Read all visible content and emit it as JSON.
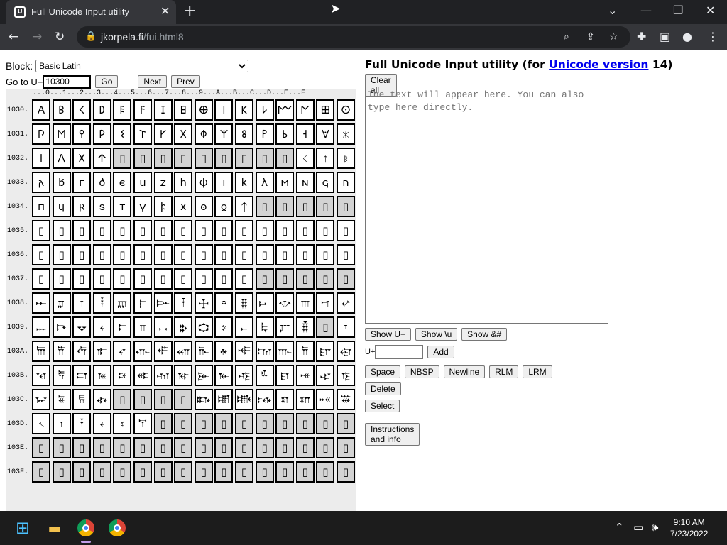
{
  "tab": {
    "title": "Full Unicode Input utility",
    "close": "✕",
    "new_tab": "+"
  },
  "window_controls": {
    "minimize": "—",
    "restore": "❐",
    "close": "✕",
    "tabs_menu": "⌄"
  },
  "toolbar": {
    "back": "←",
    "forward": "→",
    "reload": "↻",
    "url_host": "jkorpela.fi",
    "url_path": "/fui.html8"
  },
  "left": {
    "block_label": "Block:",
    "block_selected": "Basic Latin",
    "goto_label": "Go to U+",
    "goto_value": "10300",
    "go_button": "Go",
    "next_button": "Next",
    "prev_button": "Prev",
    "column_header": "...0...1...2...3...4...5...6...7...8...9...A...B...C...D...E...F"
  },
  "grid_rows": [
    {
      "label": "1030.",
      "cells": [
        "𐌀",
        "𐌁",
        "𐌂",
        "𐌃",
        "𐌄",
        "𐌅",
        "𐌆",
        "𐌇",
        "𐌈",
        "𐌉",
        "𐌊",
        "𐌋",
        "𐌌",
        "𐌍",
        "𐌎",
        "𐌏"
      ],
      "na": []
    },
    {
      "label": "1031.",
      "cells": [
        "𐌐",
        "𐌑",
        "𐌒",
        "𐌓",
        "𐌔",
        "𐌕",
        "𐌖",
        "𐌗",
        "𐌘",
        "𐌙",
        "𐌚",
        "𐌛",
        "𐌜",
        "𐌝",
        "𐌞",
        "𐌟"
      ],
      "na": []
    },
    {
      "label": "1032.",
      "cells": [
        "𐌠",
        "𐌡",
        "𐌢",
        "𐌣",
        "▯",
        "▯",
        "▯",
        "▯",
        "▯",
        "▯",
        "▯",
        "▯",
        "▯",
        "𐌭",
        "𐌮",
        "𐌯"
      ],
      "na": [
        4,
        5,
        6,
        7,
        8,
        9,
        10,
        11,
        12
      ]
    },
    {
      "label": "1033.",
      "cells": [
        "𐌰",
        "𐌱",
        "𐌲",
        "𐌳",
        "𐌴",
        "𐌵",
        "𐌶",
        "𐌷",
        "𐌸",
        "𐌹",
        "𐌺",
        "𐌻",
        "𐌼",
        "𐌽",
        "𐌾",
        "𐌿"
      ],
      "na": []
    },
    {
      "label": "1034.",
      "cells": [
        "𐍀",
        "𐍁",
        "𐍂",
        "𐍃",
        "𐍄",
        "𐍅",
        "𐍆",
        "𐍇",
        "𐍈",
        "𐍉",
        "𐍊",
        "▯",
        "▯",
        "▯",
        "▯",
        "▯"
      ],
      "na": [
        11,
        12,
        13,
        14,
        15
      ]
    },
    {
      "label": "1035.",
      "cells": [
        "▯",
        "▯",
        "▯",
        "▯",
        "▯",
        "▯",
        "▯",
        "▯",
        "▯",
        "▯",
        "▯",
        "▯",
        "▯",
        "▯",
        "▯",
        "▯"
      ],
      "na": []
    },
    {
      "label": "1036.",
      "cells": [
        "▯",
        "▯",
        "▯",
        "▯",
        "▯",
        "▯",
        "▯",
        "▯",
        "▯",
        "▯",
        "▯",
        "▯",
        "▯",
        "▯",
        "▯",
        "▯"
      ],
      "na": []
    },
    {
      "label": "1037.",
      "cells": [
        "▯",
        "▯",
        "▯",
        "▯",
        "▯",
        "▯",
        "▯",
        "▯",
        "▯",
        "▯",
        "▯",
        "▯",
        "▯",
        "▯",
        "▯",
        "▯"
      ],
      "na": [
        11,
        12,
        13,
        14,
        15
      ]
    },
    {
      "label": "1038.",
      "cells": [
        "𐎀",
        "𐎁",
        "𐎂",
        "𐎃",
        "𐎄",
        "𐎅",
        "𐎆",
        "𐎇",
        "𐎈",
        "𐎉",
        "𐎊",
        "𐎋",
        "𐎌",
        "𐎍",
        "𐎎",
        "𐎏"
      ],
      "na": []
    },
    {
      "label": "1039.",
      "cells": [
        "𐎐",
        "𐎑",
        "𐎒",
        "𐎓",
        "𐎔",
        "𐎕",
        "𐎖",
        "𐎗",
        "𐎘",
        "𐎙",
        "𐎚",
        "𐎛",
        "𐎜",
        "𐎝",
        "▯",
        "𐎟"
      ],
      "na": [
        14
      ]
    },
    {
      "label": "103A.",
      "cells": [
        "𐎠",
        "𐎡",
        "𐎢",
        "𐎣",
        "𐎤",
        "𐎥",
        "𐎦",
        "𐎧",
        "𐎨",
        "𐎩",
        "𐎪",
        "𐎫",
        "𐎬",
        "𐎭",
        "𐎮",
        "𐎯"
      ],
      "na": []
    },
    {
      "label": "103B.",
      "cells": [
        "𐎰",
        "𐎱",
        "𐎲",
        "𐎳",
        "𐎴",
        "𐎵",
        "𐎶",
        "𐎷",
        "𐎸",
        "𐎹",
        "𐎺",
        "𐎻",
        "𐎼",
        "𐎽",
        "𐎾",
        "𐎿"
      ],
      "na": []
    },
    {
      "label": "103C.",
      "cells": [
        "𐏀",
        "𐏁",
        "𐏂",
        "𐏃",
        "▯",
        "▯",
        "▯",
        "▯",
        "𐏈",
        "𐏉",
        "𐏊",
        "𐏋",
        "𐏌",
        "𐏍",
        "𐏎",
        "𐏏"
      ],
      "na": [
        4,
        5,
        6,
        7
      ]
    },
    {
      "label": "103D.",
      "cells": [
        "𐏐",
        "𐏑",
        "𐏒",
        "𐏓",
        "𐏔",
        "𐏕",
        "▯",
        "▯",
        "▯",
        "▯",
        "▯",
        "▯",
        "▯",
        "▯",
        "▯",
        "▯"
      ],
      "na": [
        6,
        7,
        8,
        9,
        10,
        11,
        12,
        13,
        14,
        15
      ]
    },
    {
      "label": "103E.",
      "cells": [
        "▯",
        "▯",
        "▯",
        "▯",
        "▯",
        "▯",
        "▯",
        "▯",
        "▯",
        "▯",
        "▯",
        "▯",
        "▯",
        "▯",
        "▯",
        "▯"
      ],
      "na": [
        0,
        1,
        2,
        3,
        4,
        5,
        6,
        7,
        8,
        9,
        10,
        11,
        12,
        13,
        14,
        15
      ]
    },
    {
      "label": "103F.",
      "cells": [
        "▯",
        "▯",
        "▯",
        "▯",
        "▯",
        "▯",
        "▯",
        "▯",
        "▯",
        "▯",
        "▯",
        "▯",
        "▯",
        "▯",
        "▯",
        "▯"
      ],
      "na": [
        0,
        1,
        2,
        3,
        4,
        5,
        6,
        7,
        8,
        9,
        10,
        11,
        12,
        13,
        14,
        15
      ]
    }
  ],
  "right": {
    "heading_prefix": "Full Unicode Input utility (for ",
    "heading_link": "Unicode version",
    "heading_suffix": " 14)",
    "clear_button": "Clear all",
    "textarea_placeholder": "The text will appear here. You can also type here directly.",
    "show_u_button": "Show U+",
    "show_backslash_button": "Show \\u",
    "show_entity_button": "Show &#",
    "add_prefix": "U+",
    "add_button": "Add",
    "space_button": "Space",
    "nbsp_button": "NBSP",
    "newline_button": "Newline",
    "rlm_button": "RLM",
    "lrm_button": "LRM",
    "delete_button": "Delete",
    "select_button": "Select",
    "info_button": "Instructions and info"
  },
  "taskbar": {
    "time": "9:10 AM",
    "date": "7/23/2022"
  }
}
